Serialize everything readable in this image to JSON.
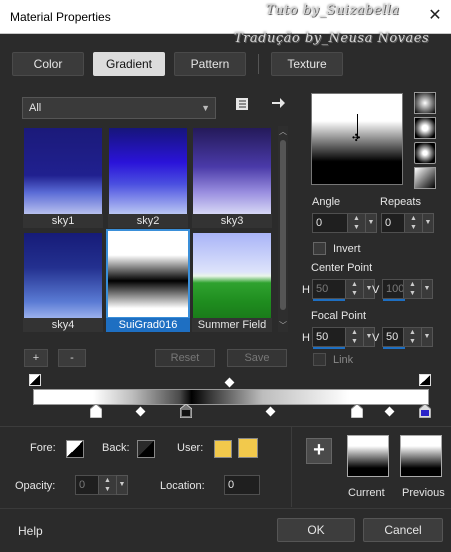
{
  "window": {
    "title": "Material Properties",
    "watermark_line1": "Tuto by_Suizabella",
    "watermark_line2": "Tradução by_Neusa Novaes",
    "close_glyph": "✕"
  },
  "tabs": [
    {
      "label": "Color",
      "active": false
    },
    {
      "label": "Gradient",
      "active": true
    },
    {
      "label": "Pattern",
      "active": false
    },
    {
      "label": "Texture",
      "active": false
    }
  ],
  "library": {
    "category_selected": "All",
    "book_icon": "book-icon",
    "arrow_icon": "arrow-right-icon",
    "thumbnails": [
      {
        "label": "sky1",
        "selected": false
      },
      {
        "label": "sky2",
        "selected": false
      },
      {
        "label": "sky3",
        "selected": false
      },
      {
        "label": "sky4",
        "selected": false
      },
      {
        "label": "SuiGrad016",
        "selected": true
      },
      {
        "label": "Summer Field",
        "selected": false
      }
    ],
    "add_label": "+",
    "remove_label": "-",
    "reset_label": "Reset",
    "save_label": "Save"
  },
  "settings": {
    "angle_label": "Angle",
    "angle_value": "0",
    "repeats_label": "Repeats",
    "repeats_value": "0",
    "invert_label": "Invert",
    "invert_checked": false,
    "center_point_label": "Center Point",
    "center_h_label": "H",
    "center_h_value": "50",
    "center_v_label": "V",
    "center_v_value": "100",
    "focal_point_label": "Focal Point",
    "focal_h_label": "H",
    "focal_h_value": "50",
    "focal_v_label": "V",
    "focal_v_value": "50",
    "link_label": "Link",
    "link_checked": false
  },
  "editor": {
    "fore_label": "Fore:",
    "back_label": "Back:",
    "user_label": "User:",
    "user_color": "#f2c94c",
    "opacity_label": "Opacity:",
    "opacity_value": "0",
    "location_label": "Location:",
    "location_value": "0",
    "add_glyph": "+",
    "current_label": "Current",
    "previous_label": "Previous"
  },
  "footer": {
    "help_label": "Help",
    "ok_label": "OK",
    "cancel_label": "Cancel"
  },
  "colors": {
    "accent_blue": "#1e6fc2",
    "selected_border": "#3a8fd9",
    "dialog_bg": "#2b2b2b"
  }
}
